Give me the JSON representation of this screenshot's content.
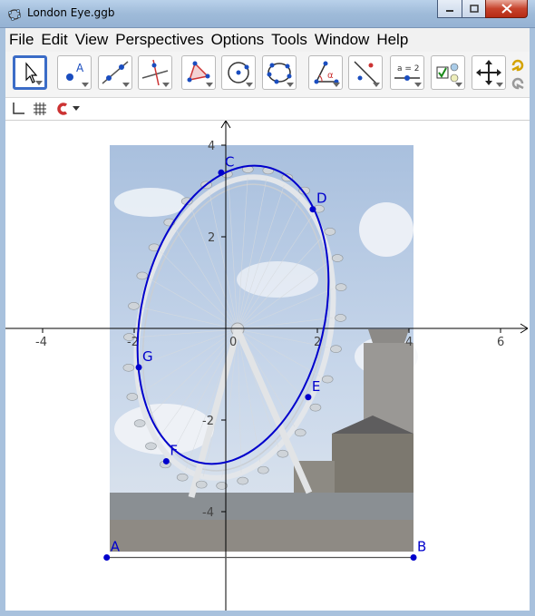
{
  "window": {
    "title": "London Eye.ggb"
  },
  "menu": [
    "File",
    "Edit",
    "View",
    "Perspectives",
    "Options",
    "Tools",
    "Window",
    "Help"
  ],
  "toolbar": {
    "tools": [
      "move-tool",
      "point-tool",
      "line-tool",
      "perpendicular-tool",
      "polygon-tool",
      "circle-tool",
      "conic-tool",
      "angle-tool",
      "reflect-tool",
      "slider-tool",
      "checkbox-tool",
      "move-graphics-tool"
    ]
  },
  "axes": {
    "x_ticks": [
      "-4",
      "-2",
      "0",
      "2",
      "4",
      "6"
    ],
    "y_ticks": [
      "4",
      "2",
      "0",
      "-2",
      "-4"
    ]
  },
  "points": [
    {
      "name": "A",
      "x": -2.6,
      "y": -5
    },
    {
      "name": "B",
      "x": 4.1,
      "y": -5
    },
    {
      "name": "C",
      "x": -0.1,
      "y": 3.4
    },
    {
      "name": "D",
      "x": 1.9,
      "y": 2.6
    },
    {
      "name": "E",
      "x": 1.8,
      "y": -1.5
    },
    {
      "name": "F",
      "x": -1.3,
      "y": -2.9
    },
    {
      "name": "G",
      "x": -1.9,
      "y": -0.85
    }
  ],
  "colors": {
    "accent": "#0000cc",
    "axes": "#000000"
  }
}
